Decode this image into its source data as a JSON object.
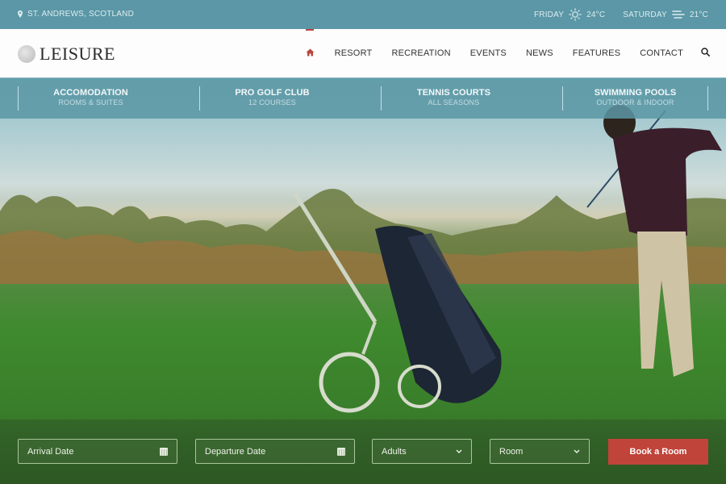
{
  "topbar": {
    "location": "ST. ANDREWS, SCOTLAND",
    "location_icon": "map-pin-icon",
    "weather": [
      {
        "day": "FRIDAY",
        "icon": "sun-icon",
        "temp": "24°C"
      },
      {
        "day": "SATURDAY",
        "icon": "wind-icon",
        "temp": "21°C"
      }
    ]
  },
  "header": {
    "logo_text": "LEISURE",
    "nav": {
      "home_icon": "home-icon",
      "items": [
        "RESORT",
        "RECREATION",
        "EVENTS",
        "NEWS",
        "FEATURES",
        "CONTACT"
      ],
      "search_icon": "search-icon"
    },
    "accent_color": "#b8473c"
  },
  "categories": [
    {
      "title": "ACCOMODATION",
      "subtitle": "ROOMS & SUITES"
    },
    {
      "title": "PRO GOLF CLUB",
      "subtitle": "12 COURSES"
    },
    {
      "title": "TENNIS COURTS",
      "subtitle": "ALL SEASONS"
    },
    {
      "title": "SWIMMING POOLS",
      "subtitle": "OUTDOOR & INDOOR"
    }
  ],
  "hero": {
    "image_description": "Golfer swinging on a green fairway next to a golf trolley with bag, autumn trees in background"
  },
  "booking": {
    "arrival_placeholder": "Arrival Date",
    "departure_placeholder": "Departure Date",
    "adults_label": "Adults",
    "room_label": "Room",
    "book_button": "Book a Room",
    "button_color": "#c0443a"
  }
}
